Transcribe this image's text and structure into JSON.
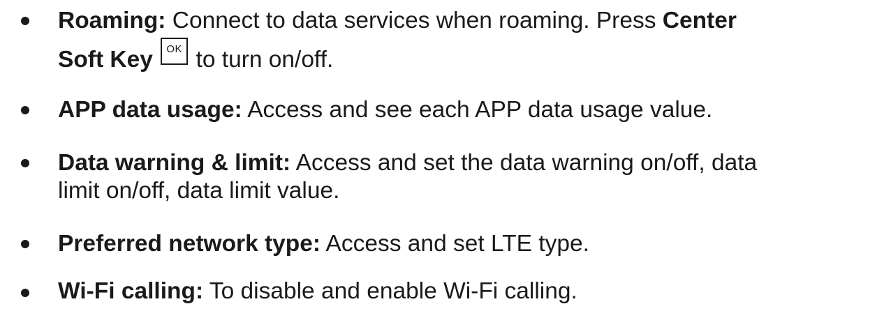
{
  "items": [
    {
      "term": "Roaming:",
      "desc_line1": " Connect to data services when roaming. Press ",
      "emphasis": "Center",
      "emphasis_line2": "Soft Key",
      "key_icon_label": "OK",
      "desc_line2": " to turn on/off."
    },
    {
      "term": "APP data usage:",
      "desc": " Access and see each APP data usage value."
    },
    {
      "term": "Data warning & limit:",
      "desc_line1": " Access and set the data warning on/off, data",
      "desc_line2": "limit on/off, data limit value."
    },
    {
      "term": "Preferred network type:",
      "desc": " Access and set LTE type."
    },
    {
      "term": "Wi-Fi calling:",
      "desc": " To disable and enable Wi-Fi calling."
    }
  ]
}
